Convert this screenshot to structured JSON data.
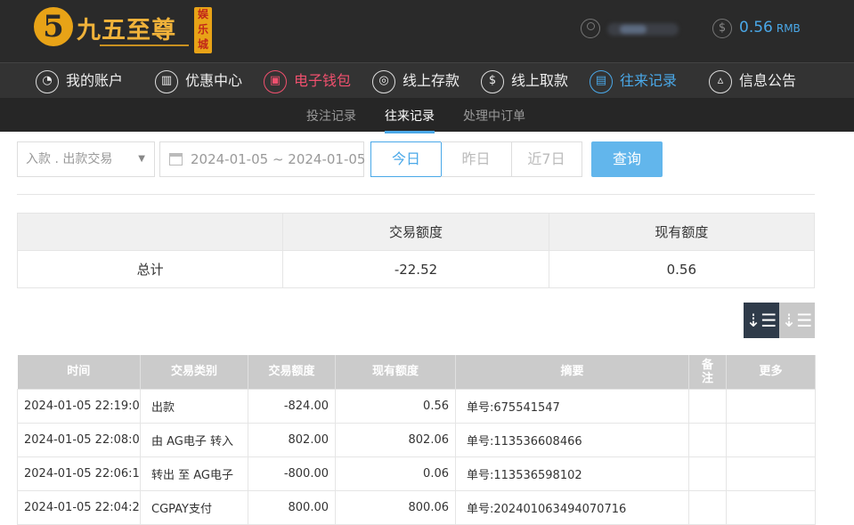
{
  "header": {
    "logo": {
      "mark": "5",
      "name": "九五至尊",
      "badge": "娱乐城"
    },
    "balance": {
      "amount": "0.56",
      "currency": "RMB"
    }
  },
  "nav": {
    "items": [
      {
        "label": "我的账户",
        "icon": "user-icon",
        "glyph": ""
      },
      {
        "label": "优惠中心",
        "icon": "gift-icon",
        "glyph": "▥"
      },
      {
        "label": "电子钱包",
        "icon": "wallet-icon",
        "glyph": "▣"
      },
      {
        "label": "线上存款",
        "icon": "deposit-icon",
        "glyph": "◎"
      },
      {
        "label": "线上取款",
        "icon": "withdraw-icon",
        "glyph": "$"
      },
      {
        "label": "往来记录",
        "icon": "records-icon",
        "glyph": "▤"
      },
      {
        "label": "信息公告",
        "icon": "bell-icon",
        "glyph": "▵"
      }
    ],
    "active_red": "电子钱包",
    "active_blue": "往来记录"
  },
  "subnav": {
    "items": [
      "投注记录",
      "往来记录",
      "处理中订单"
    ],
    "active": "往来记录"
  },
  "filters": {
    "type_select": "入款 . 出款交易",
    "date_range": "2024-01-05 ~ 2024-01-05",
    "quick": [
      "今日",
      "昨日",
      "近7日"
    ],
    "quick_active": "今日",
    "search_label": "查询"
  },
  "summary": {
    "headers": [
      "",
      "交易额度",
      "现有额度"
    ],
    "row": [
      "总计",
      "-22.52",
      "0.56"
    ]
  },
  "records": {
    "headers": [
      "时间",
      "交易类别",
      "交易额度",
      "现有额度",
      "摘要",
      "备注",
      "更多"
    ],
    "rows": [
      [
        "2024-01-05 22:19:01",
        "出款",
        "-824.00",
        "0.56",
        "单号:675541547",
        "",
        ""
      ],
      [
        "2024-01-05 22:08:07",
        "由 AG电子 转入",
        "802.00",
        "802.06",
        "单号:113536608466",
        "",
        ""
      ],
      [
        "2024-01-05 22:06:15",
        "转出 至 AG电子",
        "-800.00",
        "0.06",
        "单号:113536598102",
        "",
        ""
      ],
      [
        "2024-01-05 22:04:21",
        "CGPAY支付",
        "800.00",
        "800.06",
        "单号:202401063494070716",
        "",
        ""
      ]
    ]
  },
  "colors": {
    "accent_blue": "#4aa8e8",
    "accent_red": "#f0506e",
    "header_bg": "#2a2a2a",
    "gold": "#e8a317"
  }
}
